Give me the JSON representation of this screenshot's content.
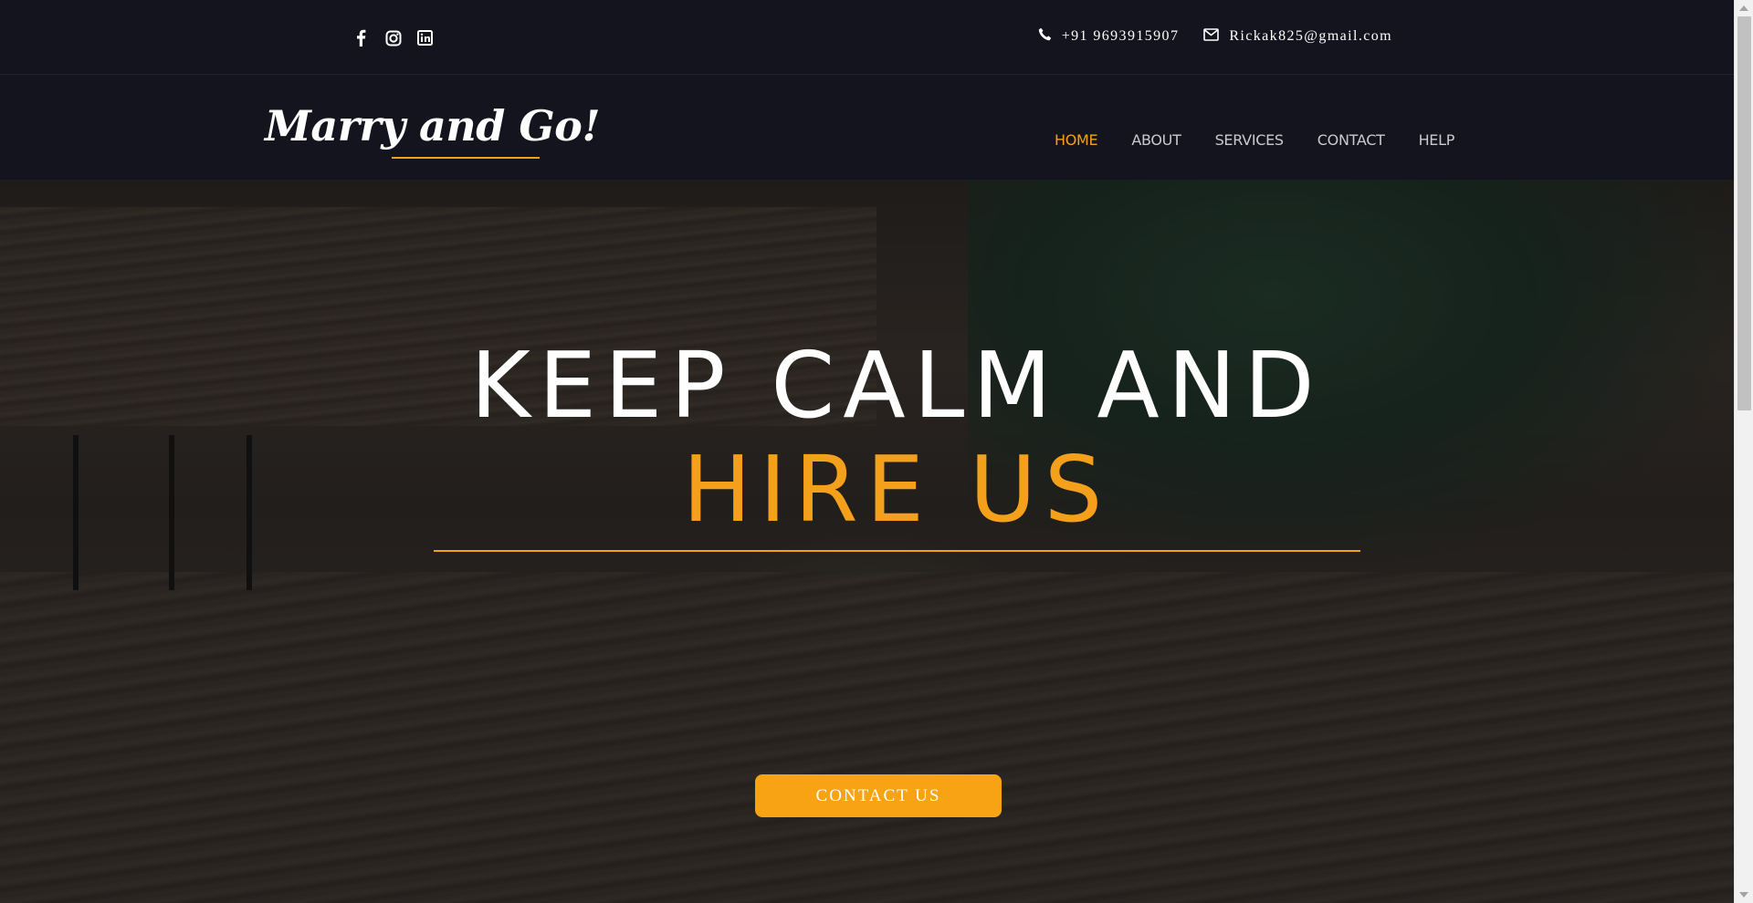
{
  "topbar": {
    "social": [
      {
        "icon": "facebook-icon"
      },
      {
        "icon": "instagram-icon"
      },
      {
        "icon": "linkedin-icon"
      }
    ],
    "phone": "+91 9693915907",
    "email": "Rickak825@gmail.com"
  },
  "header": {
    "logo": "Marry and Go!",
    "nav": [
      {
        "label": "HOME",
        "active": true
      },
      {
        "label": "ABOUT",
        "active": false
      },
      {
        "label": "SERVICES",
        "active": false
      },
      {
        "label": "CONTACT",
        "active": false
      },
      {
        "label": "HELP",
        "active": false
      }
    ]
  },
  "hero": {
    "line1": "KEEP CALM AND",
    "line2": "HIRE US",
    "cta": "CONTACT US"
  },
  "colors": {
    "accent": "#f5a01a",
    "background": "#14141f",
    "text": "#ffffff",
    "nav_text": "#c9c9cf"
  }
}
